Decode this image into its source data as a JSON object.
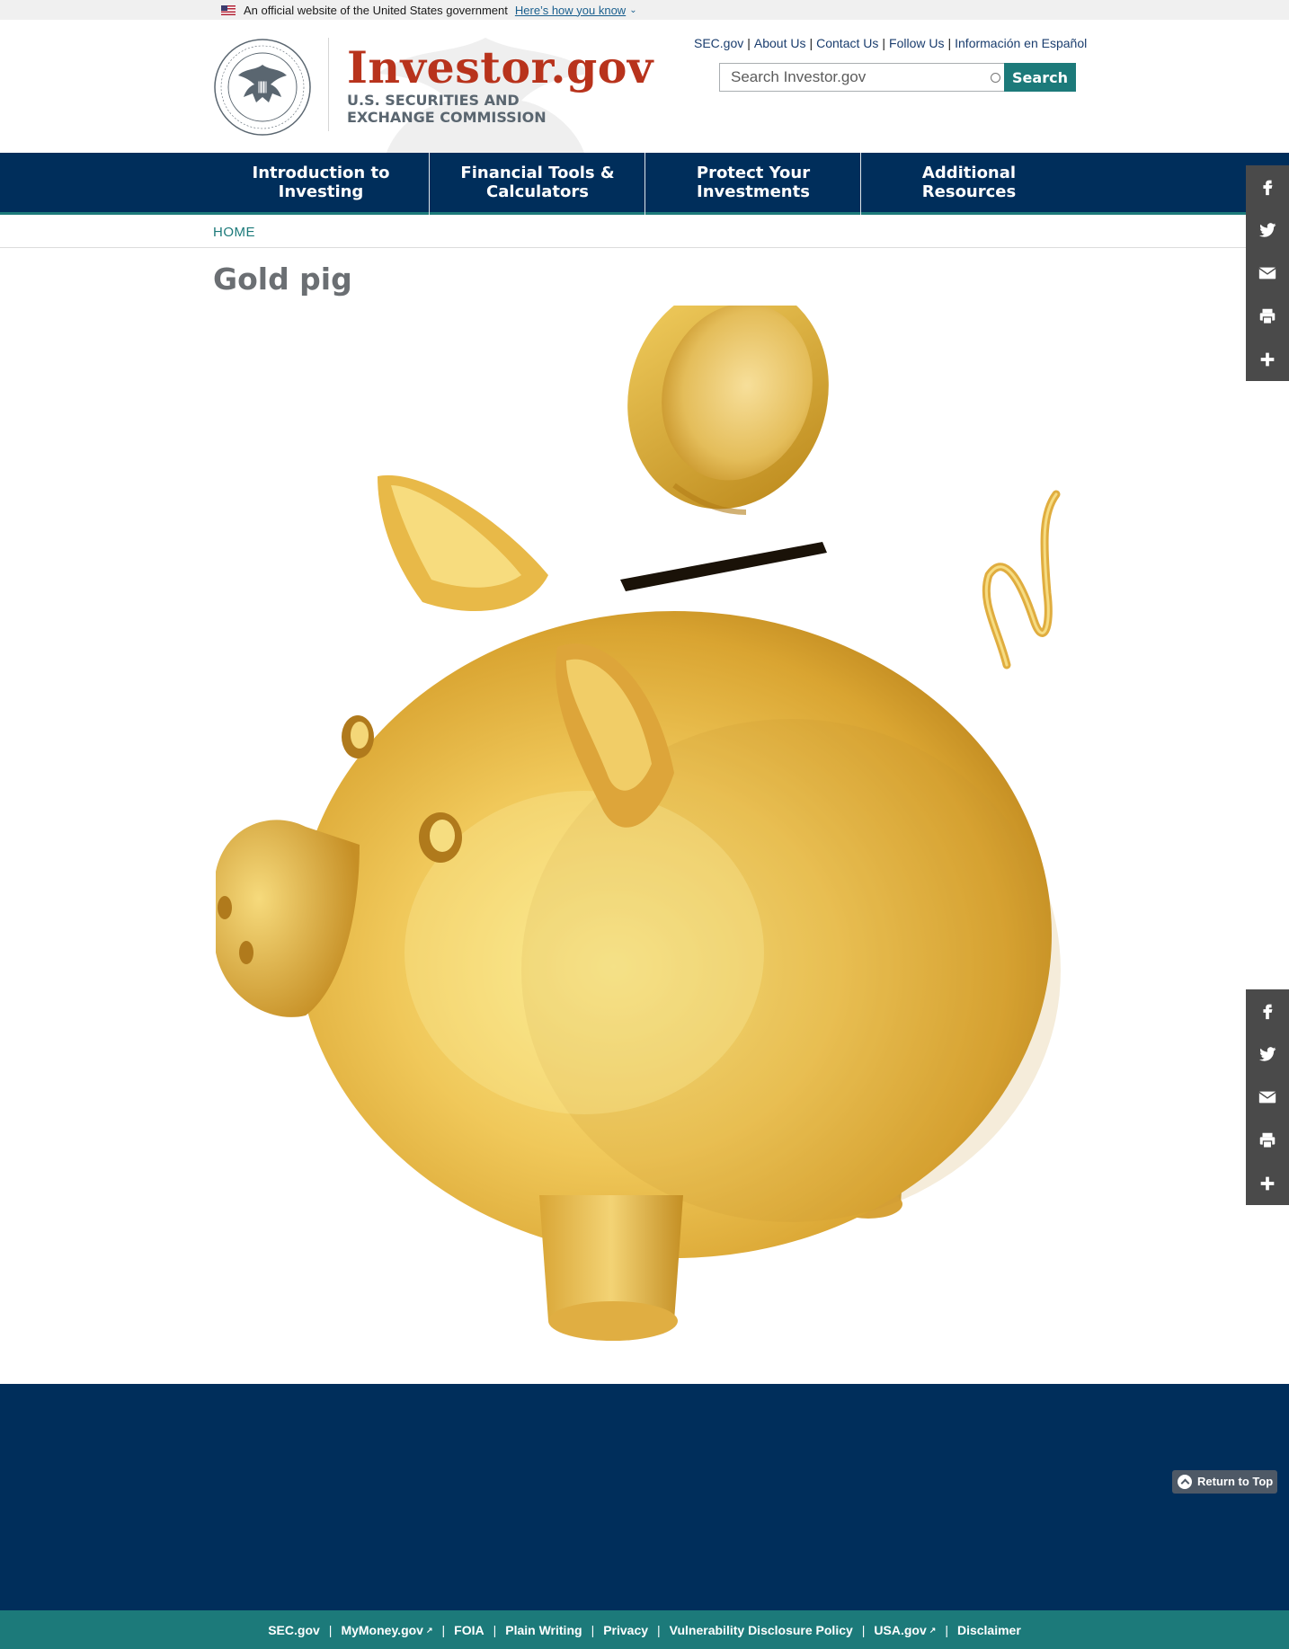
{
  "banner": {
    "text": "An official website of the United States government",
    "link": "Here’s how you know"
  },
  "header": {
    "logo_title": "Investor.gov",
    "logo_sub_line1": "U.S. SECURITIES AND",
    "logo_sub_line2": "EXCHANGE COMMISSION",
    "util_links": [
      "SEC.gov",
      "About Us",
      "Contact Us",
      "Follow Us",
      "Información en Español"
    ],
    "search_placeholder": "Search Investor.gov",
    "search_button": "Search"
  },
  "nav": {
    "items": [
      {
        "line1": "Introduction to",
        "line2": "Investing"
      },
      {
        "line1": "Financial Tools &",
        "line2": "Calculators"
      },
      {
        "line1": "Protect Your",
        "line2": "Investments"
      },
      {
        "line1": "Additional",
        "line2": "Resources"
      }
    ]
  },
  "breadcrumb": {
    "home": "HOME"
  },
  "page": {
    "title": "Gold pig"
  },
  "share_icons": [
    "facebook-icon",
    "twitter-icon",
    "email-icon",
    "print-icon",
    "plus-icon"
  ],
  "return_to_top": "Return to Top",
  "footer_links": [
    {
      "label": "SEC.gov",
      "external": false
    },
    {
      "label": "MyMoney.gov",
      "external": true
    },
    {
      "label": "FOIA",
      "external": false
    },
    {
      "label": "Plain Writing",
      "external": false
    },
    {
      "label": "Privacy",
      "external": false
    },
    {
      "label": "Vulnerability Disclosure Policy",
      "external": false
    },
    {
      "label": "USA.gov",
      "external": true
    },
    {
      "label": "Disclaimer",
      "external": false
    }
  ],
  "colors": {
    "navy": "#002e5b",
    "teal": "#1c7a7a",
    "logo_red": "#b8331c",
    "gold": "#e7b33a"
  }
}
